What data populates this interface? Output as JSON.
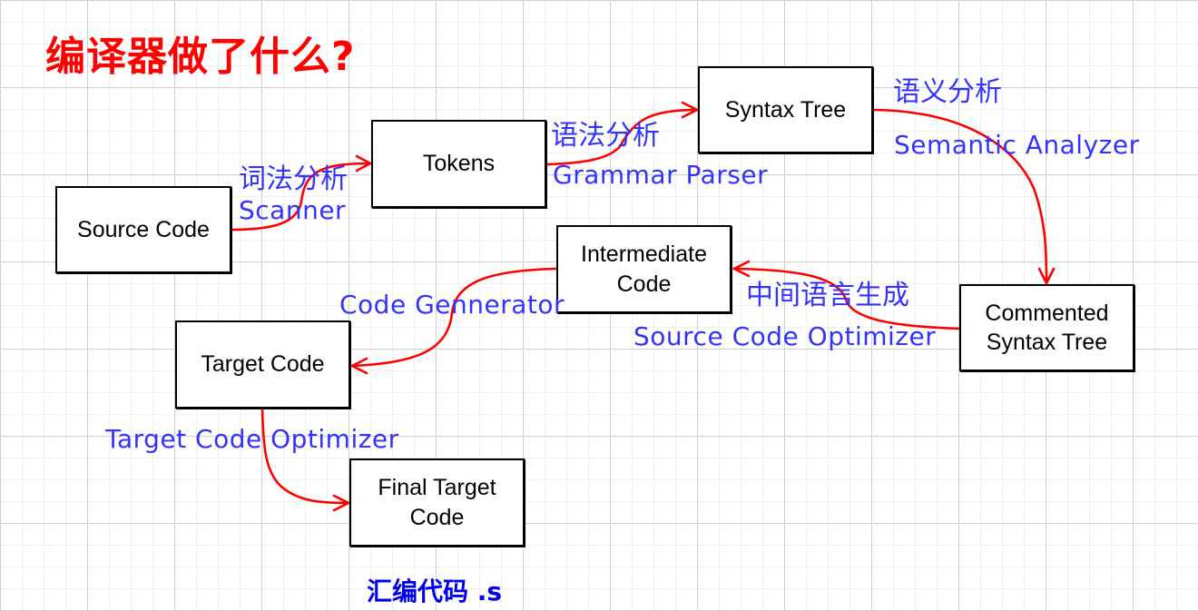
{
  "title": "编译器做了什么?",
  "nodes": {
    "source_code": "Source Code",
    "tokens": "Tokens",
    "syntax_tree": "Syntax Tree",
    "commented_syntax_tree": [
      "Commented",
      "Syntax Tree"
    ],
    "intermediate_code": [
      "Intermediate",
      "Code"
    ],
    "target_code": "Target Code",
    "final_target_code": [
      "Final Target",
      "Code"
    ]
  },
  "edges": [
    {
      "from": "source_code",
      "to": "tokens",
      "label_cn": "词法分析",
      "label_en": "Scanner"
    },
    {
      "from": "tokens",
      "to": "syntax_tree",
      "label_cn": "语法分析",
      "label_en": "Grammar Parser"
    },
    {
      "from": "syntax_tree",
      "to": "commented_syntax_tree",
      "label_cn": "语义分析",
      "label_en": "Semantic Analyzer"
    },
    {
      "from": "commented_syntax_tree",
      "to": "intermediate_code",
      "label_cn": "中间语言生成",
      "label_en": "Source Code Optimizer"
    },
    {
      "from": "intermediate_code",
      "to": "target_code",
      "label_en": "Code Gennerator"
    },
    {
      "from": "target_code",
      "to": "final_target_code",
      "label_en": "Target Code Optimizer"
    }
  ],
  "footer": "汇编代码 .s",
  "colors": {
    "title": "#ff0000",
    "arrow": "#ff0000",
    "label": "#3333ff",
    "footer": "#0000ee",
    "node_border": "#000000"
  }
}
